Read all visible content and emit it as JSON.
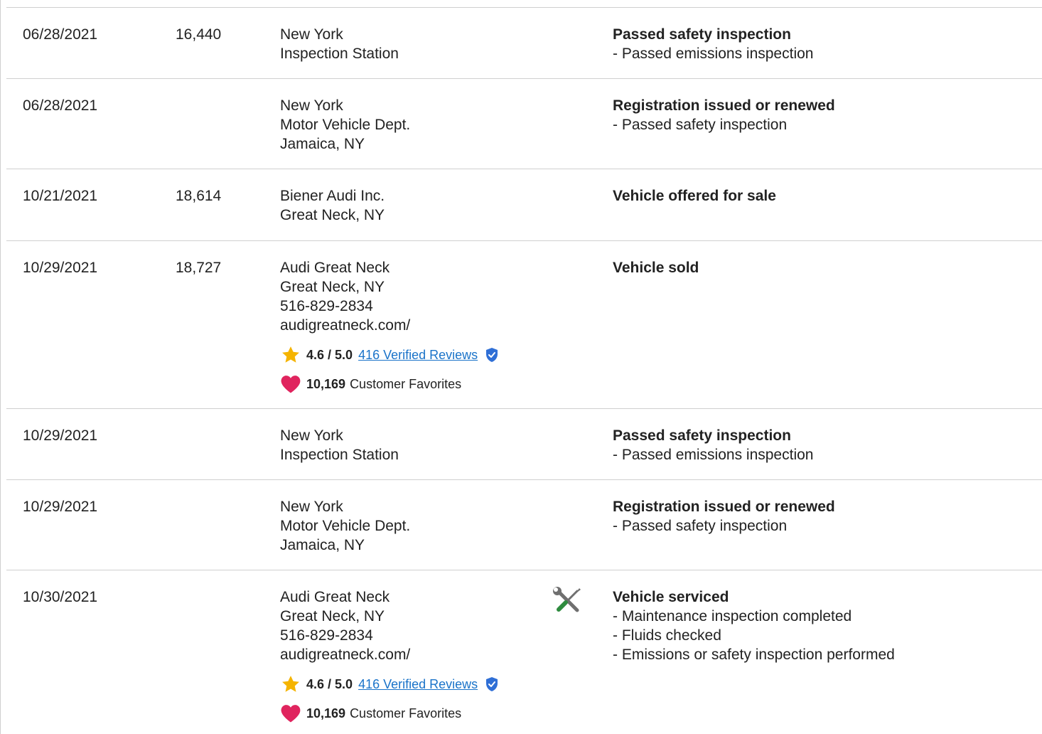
{
  "colors": {
    "star": "#f5b400",
    "heart": "#e0245e",
    "shield": "#2f6fd6",
    "link": "#1a73c9",
    "wrench": "#6f6f6f",
    "screwdriver": "#2e8b3e",
    "divider": "#cfcfcf"
  },
  "records": [
    {
      "date": "06/28/2021",
      "odometer": "16,440",
      "source_lines": [
        "New York",
        "Inspection Station"
      ],
      "details": {
        "title": "Passed safety inspection",
        "items": [
          "- Passed emissions inspection"
        ]
      }
    },
    {
      "date": "06/28/2021",
      "odometer": "",
      "source_lines": [
        "New York",
        "Motor Vehicle Dept.",
        "Jamaica, NY"
      ],
      "details": {
        "title": "Registration issued or renewed",
        "items": [
          "- Passed safety inspection"
        ]
      }
    },
    {
      "date": "10/21/2021",
      "odometer": "18,614",
      "source_lines": [
        "Biener Audi Inc.",
        "Great Neck, NY"
      ],
      "details": {
        "title": "Vehicle offered for sale",
        "items": []
      }
    },
    {
      "date": "10/29/2021",
      "odometer": "18,727",
      "source_lines": [
        "Audi Great Neck",
        "Great Neck, NY",
        "516-829-2834",
        "audigreatneck.com/"
      ],
      "rating": {
        "score": "4.6 / 5.0",
        "reviews_link": "416 Verified Reviews",
        "favorites_count": "10,169",
        "favorites_label": "Customer Favorites"
      },
      "details": {
        "title": "Vehicle sold",
        "items": []
      }
    },
    {
      "date": "10/29/2021",
      "odometer": "",
      "source_lines": [
        "New York",
        "Inspection Station"
      ],
      "details": {
        "title": "Passed safety inspection",
        "items": [
          "- Passed emissions inspection"
        ]
      }
    },
    {
      "date": "10/29/2021",
      "odometer": "",
      "source_lines": [
        "New York",
        "Motor Vehicle Dept.",
        "Jamaica, NY"
      ],
      "details": {
        "title": "Registration issued or renewed",
        "items": [
          "- Passed safety inspection"
        ]
      }
    },
    {
      "date": "10/30/2021",
      "odometer": "",
      "source_lines": [
        "Audi Great Neck",
        "Great Neck, NY",
        "516-829-2834",
        "audigreatneck.com/"
      ],
      "rating": {
        "score": "4.6 / 5.0",
        "reviews_link": "416 Verified Reviews",
        "favorites_count": "10,169",
        "favorites_label": "Customer Favorites"
      },
      "icon": "service-tools-icon",
      "details": {
        "title": "Vehicle serviced",
        "items": [
          "- Maintenance inspection completed",
          "- Fluids checked",
          "- Emissions or safety inspection performed"
        ]
      }
    }
  ]
}
